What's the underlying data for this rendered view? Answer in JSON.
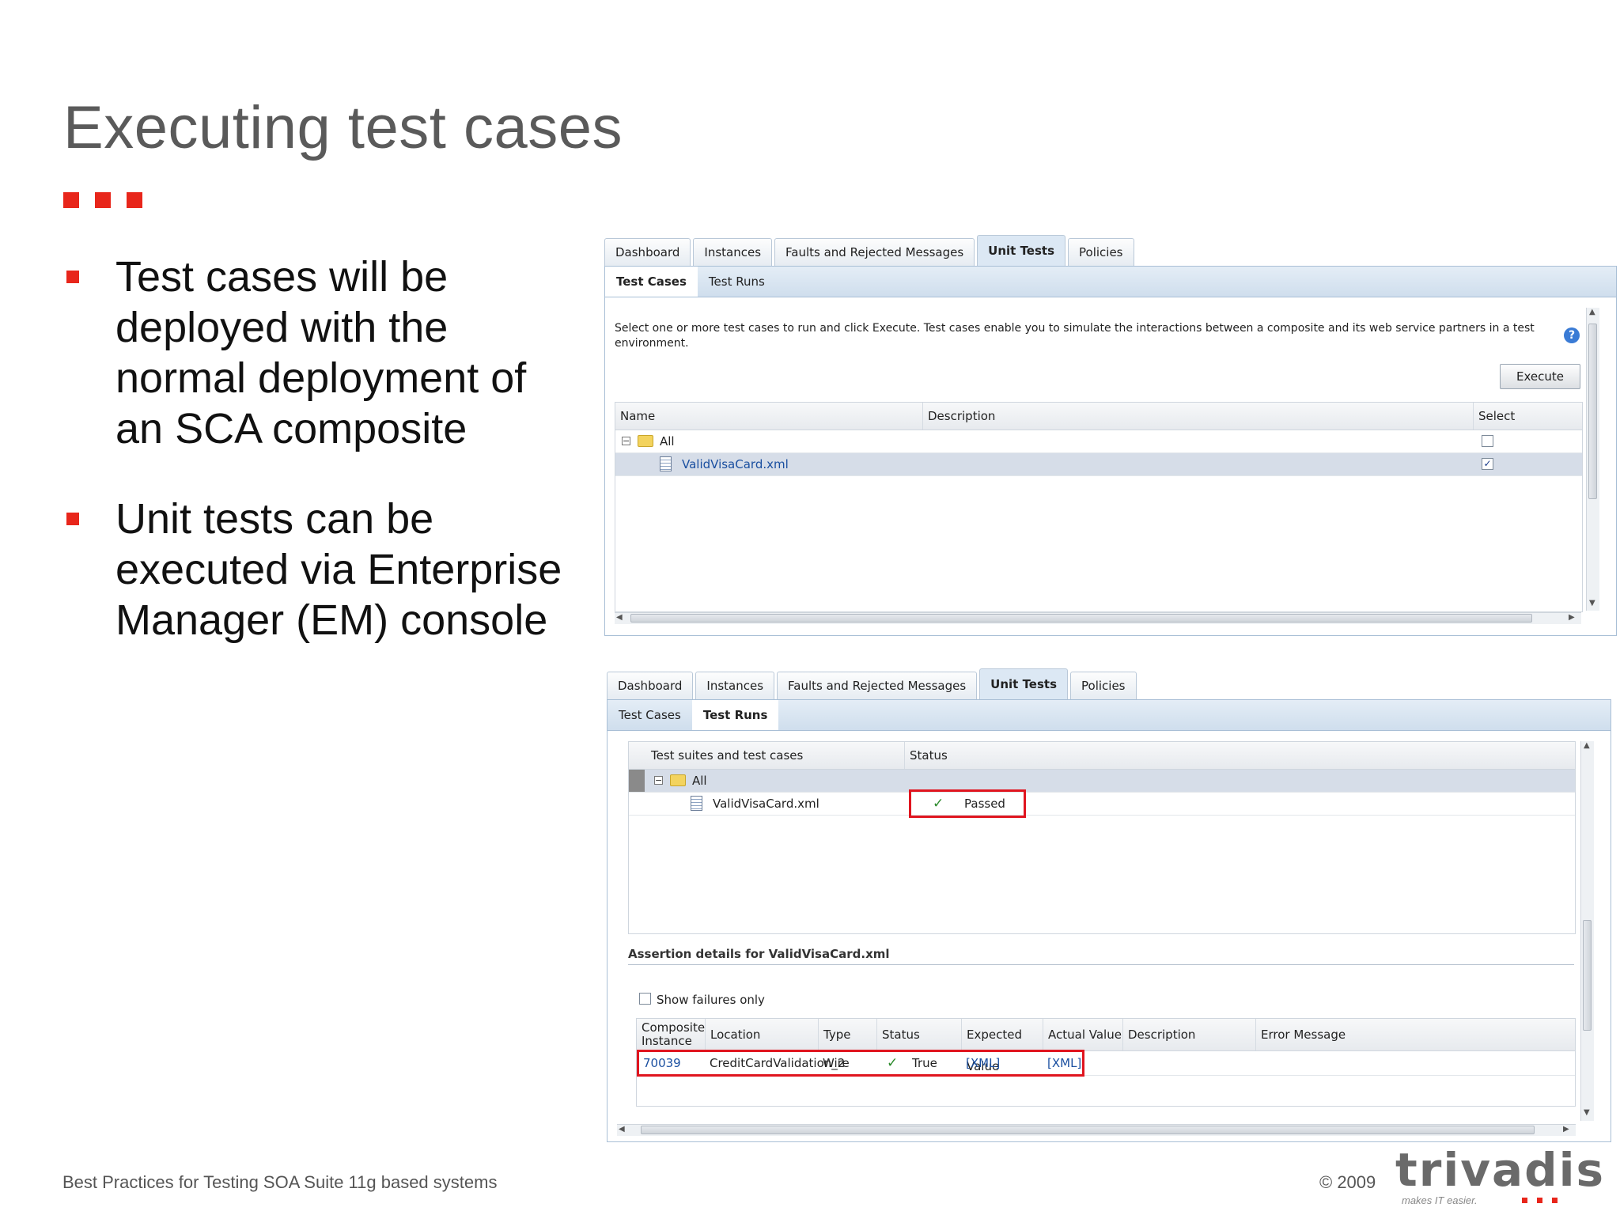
{
  "slide": {
    "title": "Executing test cases",
    "bullets": [
      "Test cases will be deployed with the normal deployment of an SCA composite",
      "Unit tests can be executed via Enterprise Manager (EM) console"
    ],
    "footer_left": "Best Practices for Testing SOA Suite 11g based systems",
    "footer_right": "© 2009",
    "logo_text": "trivadis",
    "logo_tagline": "makes IT easier.",
    "accent_color": "#e8261b"
  },
  "panel1": {
    "tabs": [
      "Dashboard",
      "Instances",
      "Faults and Rejected Messages",
      "Unit Tests",
      "Policies"
    ],
    "active_tab": "Unit Tests",
    "subtabs": [
      "Test Cases",
      "Test Runs"
    ],
    "active_subtab": "Test Cases",
    "instructions": "Select one or more test cases to run and click Execute. Test cases enable you to simulate the interactions between a composite and its web service partners in a test environment.",
    "help_icon": "?",
    "execute_label": "Execute",
    "columns": [
      "Name",
      "Description",
      "Select"
    ],
    "rows": [
      {
        "name": "All",
        "description": "",
        "selected": false,
        "icon": "folder-icon"
      },
      {
        "name": "ValidVisaCard.xml",
        "description": "",
        "selected": true,
        "icon": "document-icon"
      }
    ],
    "check_mark": "✓"
  },
  "panel2": {
    "tabs": [
      "Dashboard",
      "Instances",
      "Faults and Rejected Messages",
      "Unit Tests",
      "Policies"
    ],
    "active_tab": "Unit Tests",
    "subtabs": [
      "Test Cases",
      "Test Runs"
    ],
    "active_subtab": "Test Runs",
    "suite_columns": [
      "Test suites and test cases",
      "Status"
    ],
    "suite_rows": [
      {
        "name": "All",
        "status": "",
        "icon": "folder-icon"
      },
      {
        "name": "ValidVisaCard.xml",
        "status": "Passed",
        "icon": "document-icon"
      }
    ],
    "assertion_title": "Assertion details for ValidVisaCard.xml",
    "show_failures_label": "Show failures only",
    "assertion_columns": [
      "Composite Instance",
      "Location",
      "Type",
      "Status",
      "Expected Value",
      "Actual Value",
      "Description",
      "Error Message"
    ],
    "assertion_rows": [
      {
        "instance": "70039",
        "location": "CreditCardValidation_2",
        "type": "Wire",
        "status": "True",
        "expected": "[XML]",
        "actual": "[XML]",
        "description": "",
        "error": ""
      }
    ],
    "check_mark": "✓",
    "highlight_color": "#e0151f"
  }
}
